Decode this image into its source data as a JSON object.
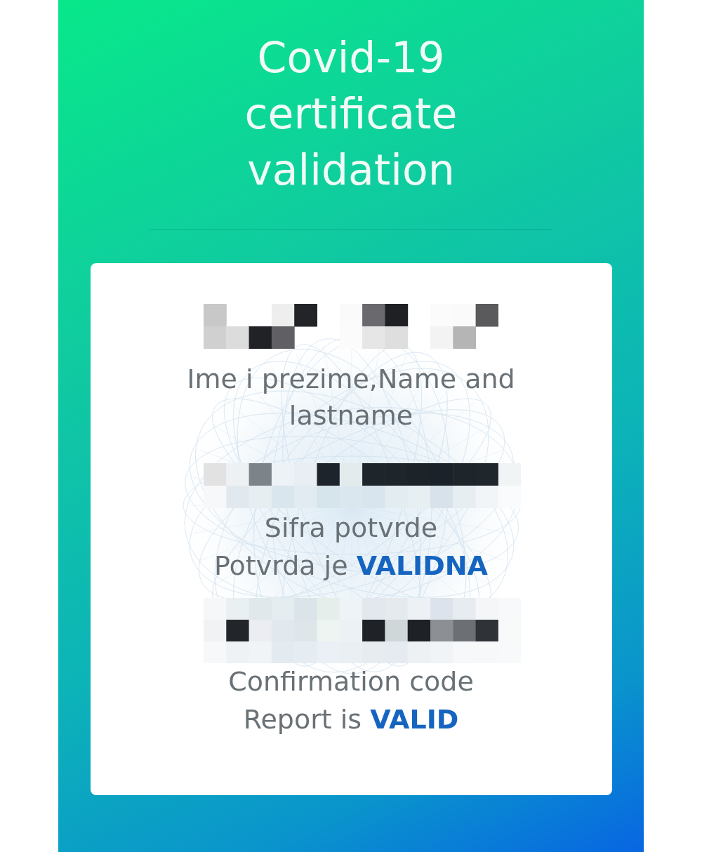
{
  "header": {
    "title": "Covid-19 certificate validation"
  },
  "card": {
    "entries": [
      {
        "redacted": true,
        "label": "Ime i prezime,Name and lastname"
      },
      {
        "redacted": true,
        "label": "Sifra potvrde",
        "status": "Potvrda je **VALIDNA**"
      },
      {
        "redacted": true,
        "label": "Confirmation code",
        "status": "Report is **VALID**"
      }
    ]
  }
}
